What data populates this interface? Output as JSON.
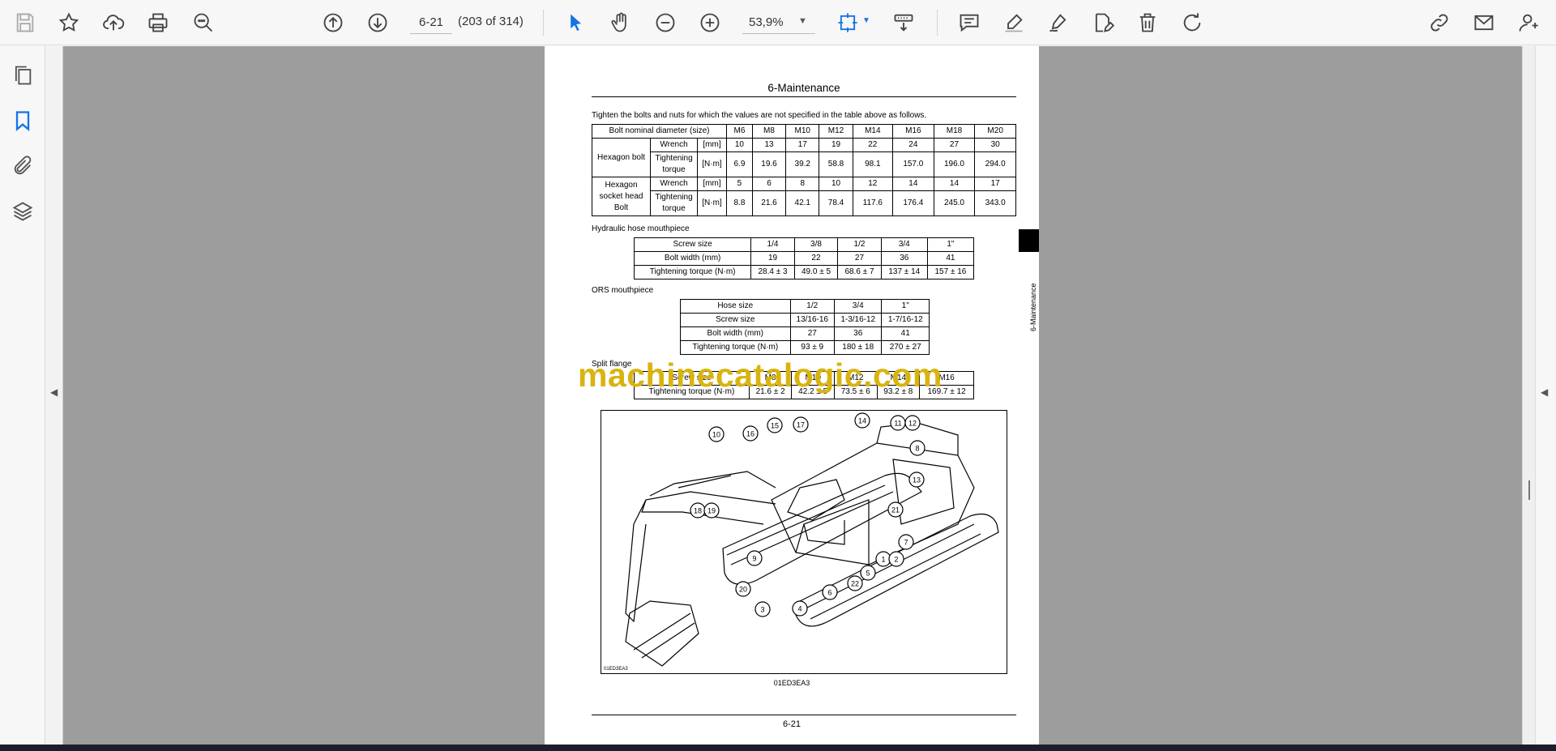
{
  "toolbar": {
    "current_page": "6-21",
    "page_count": "(203 of 314)",
    "zoom": "53,9%",
    "icons": [
      "save-icon",
      "star-icon",
      "upload-icon",
      "print-icon",
      "zoom-search-icon",
      "page-up-icon",
      "page-down-icon",
      "select-arrow-icon",
      "hand-icon",
      "zoom-out-icon",
      "zoom-in-icon",
      "fit-page-icon",
      "tools-icon",
      "comment-icon",
      "highlight-icon",
      "sign-icon",
      "edit-pdf-icon",
      "delete-icon",
      "undo-icon",
      "link-icon",
      "mail-icon",
      "account-icon"
    ]
  },
  "sidebar": {
    "icons": [
      "pages-icon",
      "bookmark-icon",
      "attachment-icon",
      "layers-icon"
    ]
  },
  "page": {
    "header": "6-Maintenance",
    "intro": "Tighten the bolts and nuts for which the values are not specified in the table above as follows.",
    "side_tab": "6-Maintenance",
    "bolt_table": {
      "header_label": "Bolt nominal diameter (size)",
      "sizes": [
        "M6",
        "M8",
        "M10",
        "M12",
        "M14",
        "M16",
        "M18",
        "M20"
      ],
      "groups": [
        {
          "name": "Hexagon bolt",
          "rows": [
            {
              "label": "Wrench",
              "unit": "[mm]",
              "values": [
                "10",
                "13",
                "17",
                "19",
                "22",
                "24",
                "27",
                "30"
              ]
            },
            {
              "label": "Tightening torque",
              "unit": "[N·m]",
              "values": [
                "6.9",
                "19.6",
                "39.2",
                "58.8",
                "98.1",
                "157.0",
                "196.0",
                "294.0"
              ]
            }
          ]
        },
        {
          "name": "Hexagon socket head Bolt",
          "rows": [
            {
              "label": "Wrench",
              "unit": "[mm]",
              "values": [
                "5",
                "6",
                "8",
                "10",
                "12",
                "14",
                "14",
                "17"
              ]
            },
            {
              "label": "Tightening torque",
              "unit": "[N·m]",
              "values": [
                "8.8",
                "21.6",
                "42.1",
                "78.4",
                "117.6",
                "176.4",
                "245.0",
                "343.0"
              ]
            }
          ]
        }
      ]
    },
    "hydraulic": {
      "title": "Hydraulic hose mouthpiece",
      "rows": [
        [
          "Screw size",
          "1/4",
          "3/8",
          "1/2",
          "3/4",
          "1\""
        ],
        [
          "Bolt width (mm)",
          "19",
          "22",
          "27",
          "36",
          "41"
        ],
        [
          "Tightening torque (N·m)",
          "28.4 ± 3",
          "49.0 ± 5",
          "68.6 ± 7",
          "137 ± 14",
          "157 ± 16"
        ]
      ]
    },
    "ors": {
      "title": "ORS mouthpiece",
      "rows": [
        [
          "Hose size",
          "1/2",
          "3/4",
          "1\""
        ],
        [
          "Screw size",
          "13/16-16",
          "1-3/16-12",
          "1-7/16-12"
        ],
        [
          "Bolt width (mm)",
          "27",
          "36",
          "41"
        ],
        [
          "Tightening torque (N·m)",
          "93 ± 9",
          "180 ± 18",
          "270 ± 27"
        ]
      ]
    },
    "split": {
      "title": "Split flange",
      "rows": [
        [
          "Screw size",
          "M8",
          "M10",
          "M12",
          "M14",
          "M16"
        ],
        [
          "Tightening torque (N·m)",
          "21.6 ± 2",
          "42.2 ± 5",
          "73.5 ± 6",
          "93.2 ± 8",
          "169.7 ± 12"
        ]
      ]
    },
    "figure": {
      "code_small": "01ED3EA3",
      "caption": "01ED3EA3",
      "callouts": [
        "10",
        "16",
        "15",
        "17",
        "14",
        "11",
        "12",
        "8",
        "13",
        "21",
        "7",
        "1",
        "2",
        "5",
        "22",
        "6",
        "4",
        "3",
        "20",
        "9",
        "18",
        "19"
      ]
    },
    "footer": "6-21"
  },
  "watermark": "machinecatalogic.com"
}
